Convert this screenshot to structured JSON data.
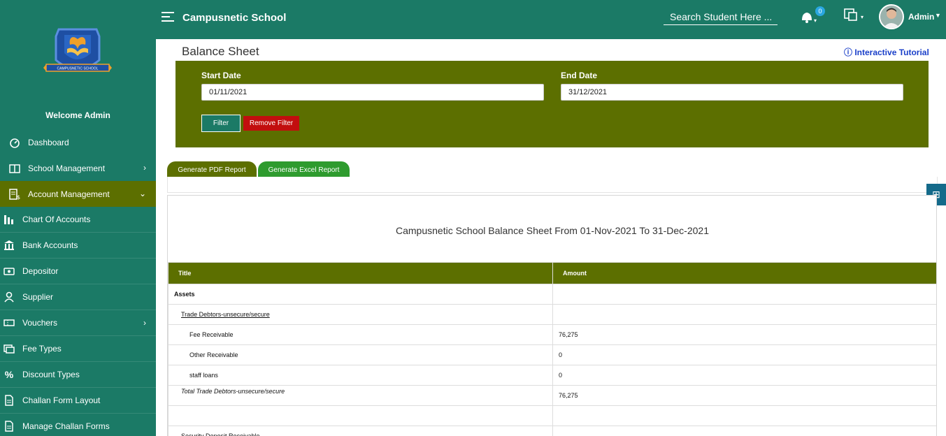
{
  "app": {
    "brand": "Campusnetic School",
    "search_placeholder": "Search Student Here ...",
    "notification_count": "0",
    "user": "Admin"
  },
  "sidebar": {
    "logo_text": "CAMPUSNETIC SCHOOL",
    "welcome": "Welcome Admin",
    "items": [
      {
        "label": "Dashboard",
        "icon": "dashboard-icon"
      },
      {
        "label": "School Management",
        "icon": "book-icon",
        "chevron": "›"
      },
      {
        "label": "Account Management",
        "icon": "invoice-dollar-icon",
        "chevron": "⌄"
      },
      {
        "label": "Chart Of Accounts",
        "icon": "chart-bar-icon"
      },
      {
        "label": "Bank Accounts",
        "icon": "bank-icon"
      },
      {
        "label": "Depositor",
        "icon": "money-icon"
      },
      {
        "label": "Supplier",
        "icon": "user-icon"
      },
      {
        "label": "Vouchers",
        "icon": "ticket-icon",
        "chevron": "›"
      },
      {
        "label": "Fee Types",
        "icon": "fee-icon"
      },
      {
        "label": "Discount Types",
        "icon": "percent-icon"
      },
      {
        "label": "Challan Form Layout",
        "icon": "document-icon"
      },
      {
        "label": "Manage Challan Forms",
        "icon": "document-icon"
      }
    ]
  },
  "page": {
    "title": "Balance Sheet",
    "tutorial": "ⓘ Interactive Tutorial",
    "filter": {
      "start_label": "Start Date",
      "start_value": "01/11/2021",
      "end_label": "End Date",
      "end_value": "31/12/2021",
      "filter_btn": "Filter",
      "remove_btn": "Remove Filter"
    },
    "tabs": {
      "pdf": "Generate PDF Report",
      "excel": "Generate Excel Report"
    },
    "report": {
      "heading": "Campusnetic School Balance Sheet From 01-Nov-2021 To 31-Dec-2021",
      "columns": [
        "Title",
        "Amount"
      ],
      "rows": [
        {
          "title": "Assets",
          "amount": ""
        },
        {
          "title": "Trade Debtors-unsecure/secure",
          "amount": ""
        },
        {
          "title": "Fee Receivable",
          "amount": "76,275"
        },
        {
          "title": "Other Receivable",
          "amount": "0"
        },
        {
          "title": "staff loans",
          "amount": "0"
        },
        {
          "title": "Total Trade Debtors-unsecure/secure",
          "amount": "76,275"
        },
        {
          "title": "",
          "amount": ""
        },
        {
          "title": "Security Deposit Receivable",
          "amount": ""
        }
      ]
    }
  }
}
